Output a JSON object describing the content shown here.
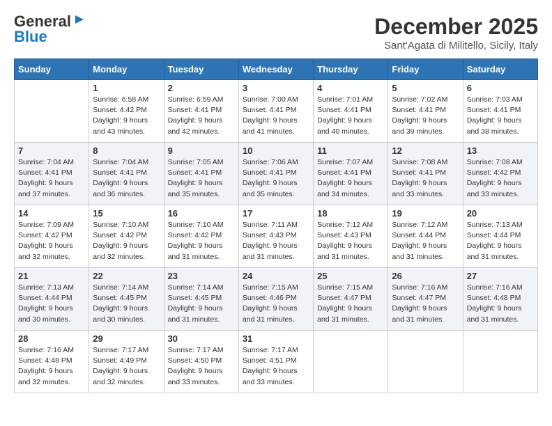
{
  "logo": {
    "general": "General",
    "blue": "Blue"
  },
  "title": "December 2025",
  "subtitle": "Sant'Agata di Militello, Sicily, Italy",
  "days_of_week": [
    "Sunday",
    "Monday",
    "Tuesday",
    "Wednesday",
    "Thursday",
    "Friday",
    "Saturday"
  ],
  "weeks": [
    [
      {
        "day": "",
        "sunrise": "",
        "sunset": "",
        "daylight": ""
      },
      {
        "day": "1",
        "sunrise": "Sunrise: 6:58 AM",
        "sunset": "Sunset: 4:42 PM",
        "daylight": "Daylight: 9 hours and 43 minutes."
      },
      {
        "day": "2",
        "sunrise": "Sunrise: 6:59 AM",
        "sunset": "Sunset: 4:41 PM",
        "daylight": "Daylight: 9 hours and 42 minutes."
      },
      {
        "day": "3",
        "sunrise": "Sunrise: 7:00 AM",
        "sunset": "Sunset: 4:41 PM",
        "daylight": "Daylight: 9 hours and 41 minutes."
      },
      {
        "day": "4",
        "sunrise": "Sunrise: 7:01 AM",
        "sunset": "Sunset: 4:41 PM",
        "daylight": "Daylight: 9 hours and 40 minutes."
      },
      {
        "day": "5",
        "sunrise": "Sunrise: 7:02 AM",
        "sunset": "Sunset: 4:41 PM",
        "daylight": "Daylight: 9 hours and 39 minutes."
      },
      {
        "day": "6",
        "sunrise": "Sunrise: 7:03 AM",
        "sunset": "Sunset: 4:41 PM",
        "daylight": "Daylight: 9 hours and 38 minutes."
      }
    ],
    [
      {
        "day": "7",
        "sunrise": "Sunrise: 7:04 AM",
        "sunset": "Sunset: 4:41 PM",
        "daylight": "Daylight: 9 hours and 37 minutes."
      },
      {
        "day": "8",
        "sunrise": "Sunrise: 7:04 AM",
        "sunset": "Sunset: 4:41 PM",
        "daylight": "Daylight: 9 hours and 36 minutes."
      },
      {
        "day": "9",
        "sunrise": "Sunrise: 7:05 AM",
        "sunset": "Sunset: 4:41 PM",
        "daylight": "Daylight: 9 hours and 35 minutes."
      },
      {
        "day": "10",
        "sunrise": "Sunrise: 7:06 AM",
        "sunset": "Sunset: 4:41 PM",
        "daylight": "Daylight: 9 hours and 35 minutes."
      },
      {
        "day": "11",
        "sunrise": "Sunrise: 7:07 AM",
        "sunset": "Sunset: 4:41 PM",
        "daylight": "Daylight: 9 hours and 34 minutes."
      },
      {
        "day": "12",
        "sunrise": "Sunrise: 7:08 AM",
        "sunset": "Sunset: 4:41 PM",
        "daylight": "Daylight: 9 hours and 33 minutes."
      },
      {
        "day": "13",
        "sunrise": "Sunrise: 7:08 AM",
        "sunset": "Sunset: 4:42 PM",
        "daylight": "Daylight: 9 hours and 33 minutes."
      }
    ],
    [
      {
        "day": "14",
        "sunrise": "Sunrise: 7:09 AM",
        "sunset": "Sunset: 4:42 PM",
        "daylight": "Daylight: 9 hours and 32 minutes."
      },
      {
        "day": "15",
        "sunrise": "Sunrise: 7:10 AM",
        "sunset": "Sunset: 4:42 PM",
        "daylight": "Daylight: 9 hours and 32 minutes."
      },
      {
        "day": "16",
        "sunrise": "Sunrise: 7:10 AM",
        "sunset": "Sunset: 4:42 PM",
        "daylight": "Daylight: 9 hours and 31 minutes."
      },
      {
        "day": "17",
        "sunrise": "Sunrise: 7:11 AM",
        "sunset": "Sunset: 4:43 PM",
        "daylight": "Daylight: 9 hours and 31 minutes."
      },
      {
        "day": "18",
        "sunrise": "Sunrise: 7:12 AM",
        "sunset": "Sunset: 4:43 PM",
        "daylight": "Daylight: 9 hours and 31 minutes."
      },
      {
        "day": "19",
        "sunrise": "Sunrise: 7:12 AM",
        "sunset": "Sunset: 4:44 PM",
        "daylight": "Daylight: 9 hours and 31 minutes."
      },
      {
        "day": "20",
        "sunrise": "Sunrise: 7:13 AM",
        "sunset": "Sunset: 4:44 PM",
        "daylight": "Daylight: 9 hours and 31 minutes."
      }
    ],
    [
      {
        "day": "21",
        "sunrise": "Sunrise: 7:13 AM",
        "sunset": "Sunset: 4:44 PM",
        "daylight": "Daylight: 9 hours and 30 minutes."
      },
      {
        "day": "22",
        "sunrise": "Sunrise: 7:14 AM",
        "sunset": "Sunset: 4:45 PM",
        "daylight": "Daylight: 9 hours and 30 minutes."
      },
      {
        "day": "23",
        "sunrise": "Sunrise: 7:14 AM",
        "sunset": "Sunset: 4:45 PM",
        "daylight": "Daylight: 9 hours and 31 minutes."
      },
      {
        "day": "24",
        "sunrise": "Sunrise: 7:15 AM",
        "sunset": "Sunset: 4:46 PM",
        "daylight": "Daylight: 9 hours and 31 minutes."
      },
      {
        "day": "25",
        "sunrise": "Sunrise: 7:15 AM",
        "sunset": "Sunset: 4:47 PM",
        "daylight": "Daylight: 9 hours and 31 minutes."
      },
      {
        "day": "26",
        "sunrise": "Sunrise: 7:16 AM",
        "sunset": "Sunset: 4:47 PM",
        "daylight": "Daylight: 9 hours and 31 minutes."
      },
      {
        "day": "27",
        "sunrise": "Sunrise: 7:16 AM",
        "sunset": "Sunset: 4:48 PM",
        "daylight": "Daylight: 9 hours and 31 minutes."
      }
    ],
    [
      {
        "day": "28",
        "sunrise": "Sunrise: 7:16 AM",
        "sunset": "Sunset: 4:48 PM",
        "daylight": "Daylight: 9 hours and 32 minutes."
      },
      {
        "day": "29",
        "sunrise": "Sunrise: 7:17 AM",
        "sunset": "Sunset: 4:49 PM",
        "daylight": "Daylight: 9 hours and 32 minutes."
      },
      {
        "day": "30",
        "sunrise": "Sunrise: 7:17 AM",
        "sunset": "Sunset: 4:50 PM",
        "daylight": "Daylight: 9 hours and 33 minutes."
      },
      {
        "day": "31",
        "sunrise": "Sunrise: 7:17 AM",
        "sunset": "Sunset: 4:51 PM",
        "daylight": "Daylight: 9 hours and 33 minutes."
      },
      {
        "day": "",
        "sunrise": "",
        "sunset": "",
        "daylight": ""
      },
      {
        "day": "",
        "sunrise": "",
        "sunset": "",
        "daylight": ""
      },
      {
        "day": "",
        "sunrise": "",
        "sunset": "",
        "daylight": ""
      }
    ]
  ]
}
